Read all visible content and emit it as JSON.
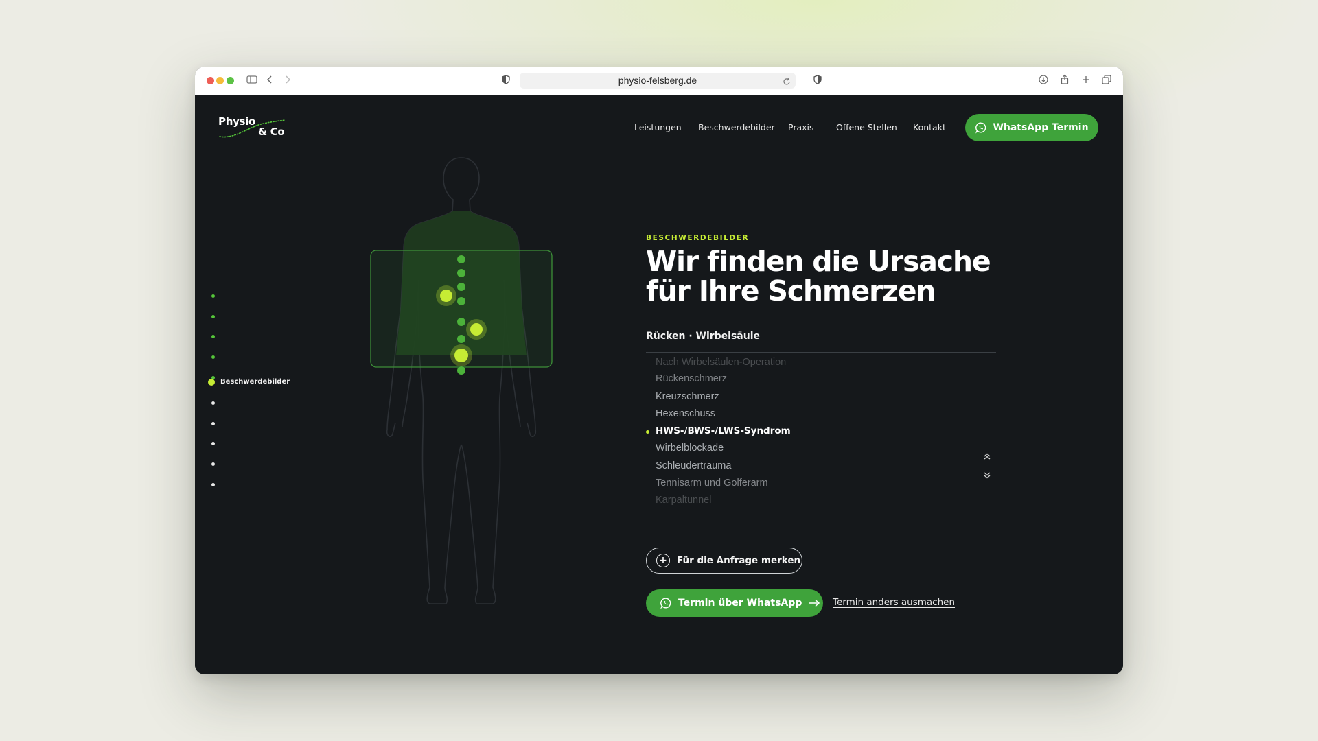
{
  "browser": {
    "url": "physio-felsberg.de"
  },
  "logo": {
    "line1": "Physio",
    "line2": "& Co"
  },
  "nav": {
    "items": [
      "Leistungen",
      "Beschwerdebilder",
      "Praxis",
      "Offene Stellen",
      "Kontakt"
    ],
    "cta_label": "WhatsApp Termin"
  },
  "side_nav": {
    "active_label": "Beschwerdebilder"
  },
  "hero": {
    "eyebrow": "BESCHWERDEBILDER",
    "headline_line1": "Wir finden die Ursache",
    "headline_line2": "für Ihre Schmerzen",
    "area_label": "Rücken · Wirbelsäule",
    "conditions": [
      "Nach Wirbelsäulen-Operation",
      "Rückenschmerz",
      "Kreuzschmerz",
      "Hexenschuss",
      "HWS-/BWS-/LWS-Syndrom",
      "Wirbelblockade",
      "Schleudertrauma",
      "Tennisarm und Golferarm",
      "Karpaltunnel"
    ],
    "selected_condition": "HWS-/BWS-/LWS-Syndrom",
    "remember_label": "Für die Anfrage merken",
    "whatsapp_label": "Termin über WhatsApp",
    "alt_link_label": "Termin anders ausmachen"
  },
  "colors": {
    "background": "#15181b",
    "accent_green": "#3fa33b",
    "accent_lime": "#c6ec34"
  }
}
